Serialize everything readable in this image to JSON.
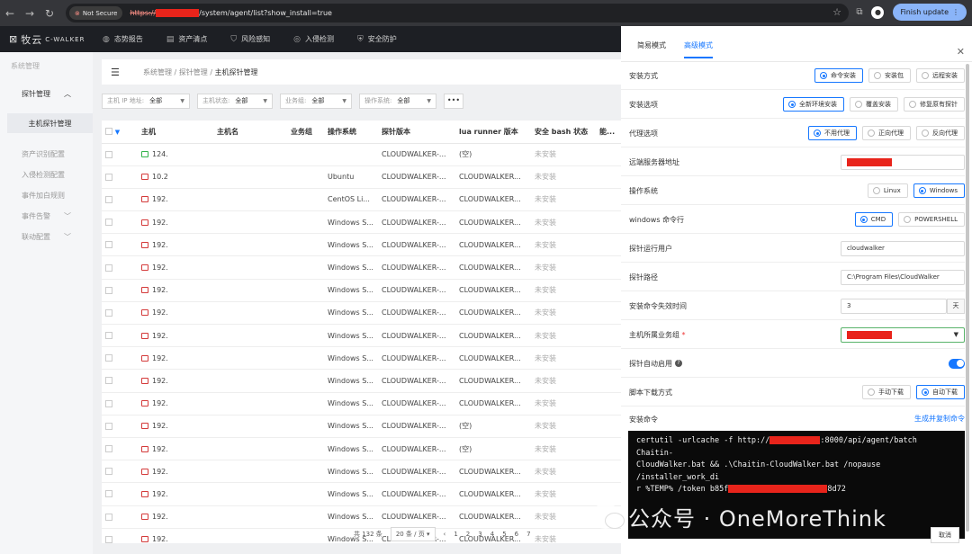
{
  "browser": {
    "not_secure": "Not Secure",
    "url_scheme": "https://",
    "url_path": "/system/agent/list?show_install=true",
    "update_label": "Finish update"
  },
  "app": {
    "logo_text": "牧云",
    "logo_sub": "C-WALKER",
    "nav": [
      "态势报告",
      "资产清点",
      "风险感知",
      "入侵检测",
      "安全防护"
    ]
  },
  "sidebar": {
    "title": "系统管理",
    "group": "探针管理",
    "active": "主机探针管理",
    "items": [
      {
        "label": "资产识别配置",
        "chevron": false
      },
      {
        "label": "入侵检测配置",
        "chevron": false
      },
      {
        "label": "事件加白规则",
        "chevron": false
      },
      {
        "label": "事件告警",
        "chevron": true
      },
      {
        "label": "联动配置",
        "chevron": true
      }
    ]
  },
  "breadcrumb": {
    "l1": "系统管理",
    "l2": "探针管理",
    "current": "主机探针管理"
  },
  "filters": [
    {
      "label": "主机 IP 地址:",
      "value": "全部"
    },
    {
      "label": "主机状态:",
      "value": "全部"
    },
    {
      "label": "业务组:",
      "value": "全部"
    },
    {
      "label": "操作系统:",
      "value": "全部"
    }
  ],
  "filter_more": "•••",
  "table": {
    "headers": [
      "主机",
      "主机名",
      "业务组",
      "操作系统",
      "探针版本",
      "lua runner 版本",
      "安全 bash 状态",
      "能..."
    ],
    "rows": [
      {
        "status": "green",
        "host": "124.",
        "os": "",
        "ver": "CLOUDWALKER-...",
        "lua": "(空)",
        "bash": "未安装"
      },
      {
        "status": "red",
        "host": "10.2",
        "os": "Ubuntu",
        "ver": "CLOUDWALKER-...",
        "lua": "CLOUDWALKER...",
        "bash": "未安装"
      },
      {
        "status": "red",
        "host": "192.",
        "os": "CentOS Li...",
        "ver": "CLOUDWALKER-...",
        "lua": "CLOUDWALKER...",
        "bash": "未安装"
      },
      {
        "status": "red",
        "host": "192.",
        "os": "Windows S...",
        "ver": "CLOUDWALKER-...",
        "lua": "CLOUDWALKER...",
        "bash": "未安装"
      },
      {
        "status": "red",
        "host": "192.",
        "os": "Windows S...",
        "ver": "CLOUDWALKER-...",
        "lua": "CLOUDWALKER...",
        "bash": "未安装"
      },
      {
        "status": "red",
        "host": "192.",
        "os": "Windows S...",
        "ver": "CLOUDWALKER-...",
        "lua": "CLOUDWALKER...",
        "bash": "未安装"
      },
      {
        "status": "red",
        "host": "192.",
        "os": "Windows S...",
        "ver": "CLOUDWALKER-...",
        "lua": "CLOUDWALKER...",
        "bash": "未安装"
      },
      {
        "status": "red",
        "host": "192.",
        "os": "Windows S...",
        "ver": "CLOUDWALKER-...",
        "lua": "CLOUDWALKER...",
        "bash": "未安装"
      },
      {
        "status": "red",
        "host": "192.",
        "os": "Windows S...",
        "ver": "CLOUDWALKER-...",
        "lua": "CLOUDWALKER...",
        "bash": "未安装"
      },
      {
        "status": "red",
        "host": "192.",
        "os": "Windows S...",
        "ver": "CLOUDWALKER-...",
        "lua": "CLOUDWALKER...",
        "bash": "未安装"
      },
      {
        "status": "red",
        "host": "192.",
        "os": "Windows S...",
        "ver": "CLOUDWALKER-...",
        "lua": "CLOUDWALKER...",
        "bash": "未安装"
      },
      {
        "status": "red",
        "host": "192.",
        "os": "Windows S...",
        "ver": "CLOUDWALKER-...",
        "lua": "CLOUDWALKER...",
        "bash": "未安装"
      },
      {
        "status": "red",
        "host": "192.",
        "os": "Windows S...",
        "ver": "CLOUDWALKER-...",
        "lua": "(空)",
        "bash": "未安装"
      },
      {
        "status": "red",
        "host": "192.",
        "os": "Windows S...",
        "ver": "CLOUDWALKER-...",
        "lua": "(空)",
        "bash": "未安装"
      },
      {
        "status": "red",
        "host": "192.",
        "os": "Windows S...",
        "ver": "CLOUDWALKER-...",
        "lua": "CLOUDWALKER...",
        "bash": "未安装"
      },
      {
        "status": "red",
        "host": "192.",
        "os": "Windows S...",
        "ver": "CLOUDWALKER-...",
        "lua": "CLOUDWALKER...",
        "bash": "未安装"
      },
      {
        "status": "red",
        "host": "192.",
        "os": "Windows S...",
        "ver": "CLOUDWALKER-...",
        "lua": "CLOUDWALKER...",
        "bash": "未安装"
      },
      {
        "status": "red",
        "host": "192.",
        "os": "Windows S...",
        "ver": "CLOUDWALKER-...",
        "lua": "CLOUDWALKER...",
        "bash": "未安装"
      }
    ]
  },
  "pager": {
    "total": "共 132 条",
    "page_size": "20 条 / 页",
    "pages": [
      "1",
      "2",
      "3",
      "4",
      "5",
      "6",
      "7"
    ]
  },
  "panel": {
    "tabs": [
      "简易模式",
      "高级模式"
    ],
    "active_tab": 1,
    "rows": [
      {
        "label": "安装方式",
        "options": [
          "命令安装",
          "安装包",
          "远程安装"
        ],
        "selected": 0
      },
      {
        "label": "安装选项",
        "options": [
          "全新环境安装",
          "覆盖安装",
          "修复原有探针"
        ],
        "selected": 0
      },
      {
        "label": "代理选项",
        "options": [
          "不用代理",
          "正向代理",
          "反向代理"
        ],
        "selected": 0
      },
      {
        "label": "远端服务器地址"
      },
      {
        "label": "操作系统",
        "options": [
          "Linux",
          "Windows"
        ],
        "selected": 1
      },
      {
        "label": "windows 命令行",
        "options": [
          "CMD",
          "POWERSHELL"
        ],
        "selected": 0
      },
      {
        "label": "探针运行用户",
        "value": "cloudwalker"
      },
      {
        "label": "探针路径",
        "value": "C:\\Program Files\\CloudWalker"
      },
      {
        "label": "安装命令失效时间",
        "value": "3",
        "unit": "天"
      },
      {
        "label": "主机所属业务组",
        "required": "*"
      },
      {
        "label": "探针自动启用",
        "help": "?"
      },
      {
        "label": "脚本下载方式",
        "options": [
          "手动下载",
          "自动下载"
        ],
        "selected": 1
      }
    ],
    "cmd_label": "安装命令",
    "cmd_link": "生成并复制命令",
    "cmd_line1a": "certutil -urlcache -f http://",
    "cmd_line1b": ":8000/api/agent/batch Chaitin-",
    "cmd_line2": "CloudWalker.bat && .\\Chaitin-CloudWalker.bat /nopause /installer_work_di",
    "cmd_line3a": "r %TEMP% /token b85f",
    "cmd_line3b": "8d72",
    "cancel": "取消"
  },
  "watermark": "公众号 · OneMoreThink",
  "colors": {
    "accent": "#1677ff",
    "redaction": "#e8241b",
    "offline": "#d43a3a",
    "online": "#33b34a"
  }
}
